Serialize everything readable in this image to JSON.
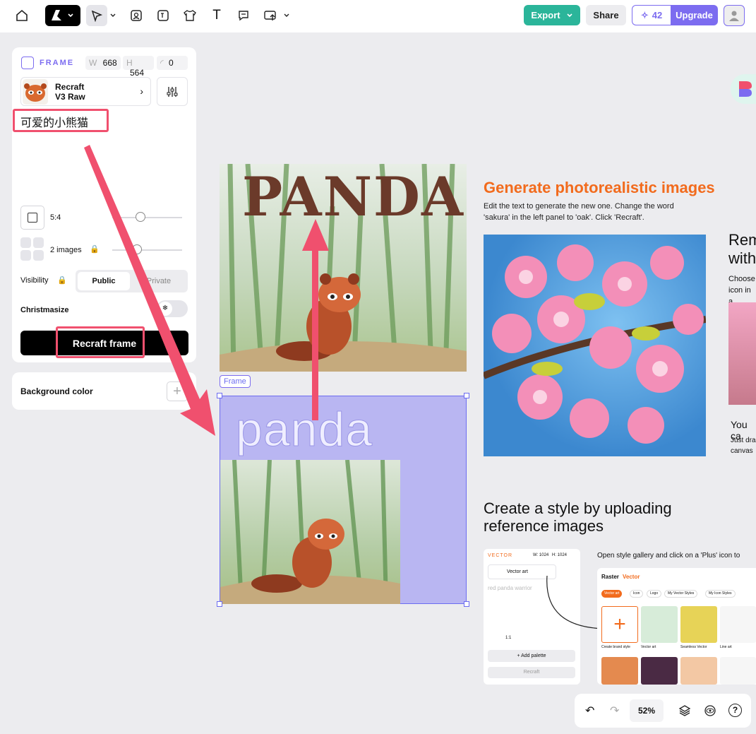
{
  "toolbar": {
    "export_label": "Export",
    "share_label": "Share",
    "credits": "42",
    "upgrade_label": "Upgrade"
  },
  "frame_panel": {
    "section_label": "FRAME",
    "w_label": "W",
    "w_value": "668",
    "h_label": "H",
    "h_value": "564",
    "radius_value": "0",
    "model_name_line1": "Recraft",
    "model_name_line2": "V3 Raw",
    "prompt_text": "可爱的小熊猫",
    "aspect_ratio": "5:4",
    "images_count": "2 images",
    "visibility_label": "Visibility",
    "visibility_public": "Public",
    "visibility_private": "Private",
    "christmasize_label": "Christmasize",
    "recraft_frame_label": "Recraft frame"
  },
  "bg_panel": {
    "label": "Background color"
  },
  "canvas": {
    "frame_tag": "Frame",
    "frame_text": "panda",
    "top_image_text": "PANDA",
    "section1_title": "Generate photorealistic images",
    "section1_desc_line1": "Edit the text to generate the new one. Change the word",
    "section1_desc_line2": "'sakura' in the left panel to 'oak'. Click 'Recraft'.",
    "section2_title_line1": "Rem",
    "section2_title_line2": "with",
    "section2_desc_line1": "Choose",
    "section2_desc_line2": "icon in a",
    "section2_sub": "You ca",
    "section2_sub_desc1": "Just dra",
    "section2_sub_desc2": "canvas",
    "section3_title_line1": "Create a style by uploading",
    "section3_title_line2": "reference images",
    "section3_gallery_hint": "Open style gallery and click on a 'Plus' icon to",
    "mini_panel": {
      "label": "VECTOR",
      "w": "W: 1024",
      "h": "H: 1024",
      "model": "Vector art",
      "prompt": "red panda warrior",
      "ratio": "1:1",
      "add_palette": "Add palette",
      "recraft": "Recraft"
    },
    "gallery": {
      "tab_raster": "Raster",
      "tab_vector": "Vector",
      "chips": [
        "Vector art",
        "Icon",
        "Logo",
        "My Vector Styles",
        "My Icon Styles"
      ],
      "items": [
        "Create brand style",
        "Vector art",
        "Seamless Vector",
        "Line art"
      ]
    }
  },
  "bottom_bar": {
    "zoom": "52%"
  },
  "colors": {
    "teal": "#2bb59a",
    "purple": "#7c6cf0",
    "frame_fill": "#b9b6f2",
    "orange_title": "#f26b1d",
    "red_annotation": "#f0506e"
  }
}
